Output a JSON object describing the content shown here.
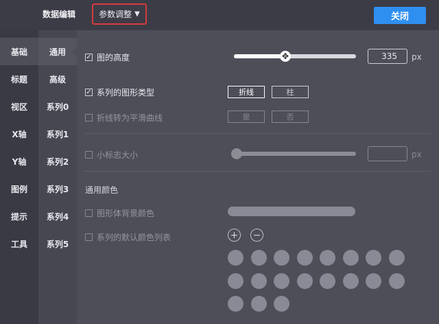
{
  "topbar": {
    "title": "数据编辑",
    "param_dropdown": "参数调整",
    "param_caret": "▼",
    "close_label": "关闭"
  },
  "nav_primary": [
    "基础",
    "标题",
    "视区",
    "X轴",
    "Y轴",
    "图例",
    "提示",
    "工具"
  ],
  "nav_secondary": [
    "通用",
    "高级",
    "系列0",
    "系列1",
    "系列2",
    "系列3",
    "系列4",
    "系列5"
  ],
  "panel": {
    "height": {
      "label": "图的高度",
      "checked": true,
      "slider_value_fraction": 0.42,
      "value": "335",
      "unit": "px"
    },
    "series_type": {
      "label": "系列的图形类型",
      "checked": true,
      "options": [
        "折线",
        "柱"
      ],
      "selected": "折线"
    },
    "smooth": {
      "label": "折线转为平滑曲线",
      "checked": false,
      "options": [
        "是",
        "否"
      ]
    },
    "marker_size": {
      "label": "小标志大小",
      "checked": false,
      "slider_value_fraction": 0.0,
      "value": "",
      "unit": "px"
    },
    "colors_section": "通用颜色",
    "bg_color": {
      "label": "图形体背景颜色",
      "checked": false
    },
    "default_colors": {
      "label": "系列的默认颜色列表",
      "checked": false,
      "add_symbol": "+",
      "remove_symbol": "−",
      "swatch_count": 19
    }
  },
  "colors": {
    "accent": "#2f8ff0",
    "highlight": "#d83b3b",
    "swatch": "#8a8a96"
  }
}
